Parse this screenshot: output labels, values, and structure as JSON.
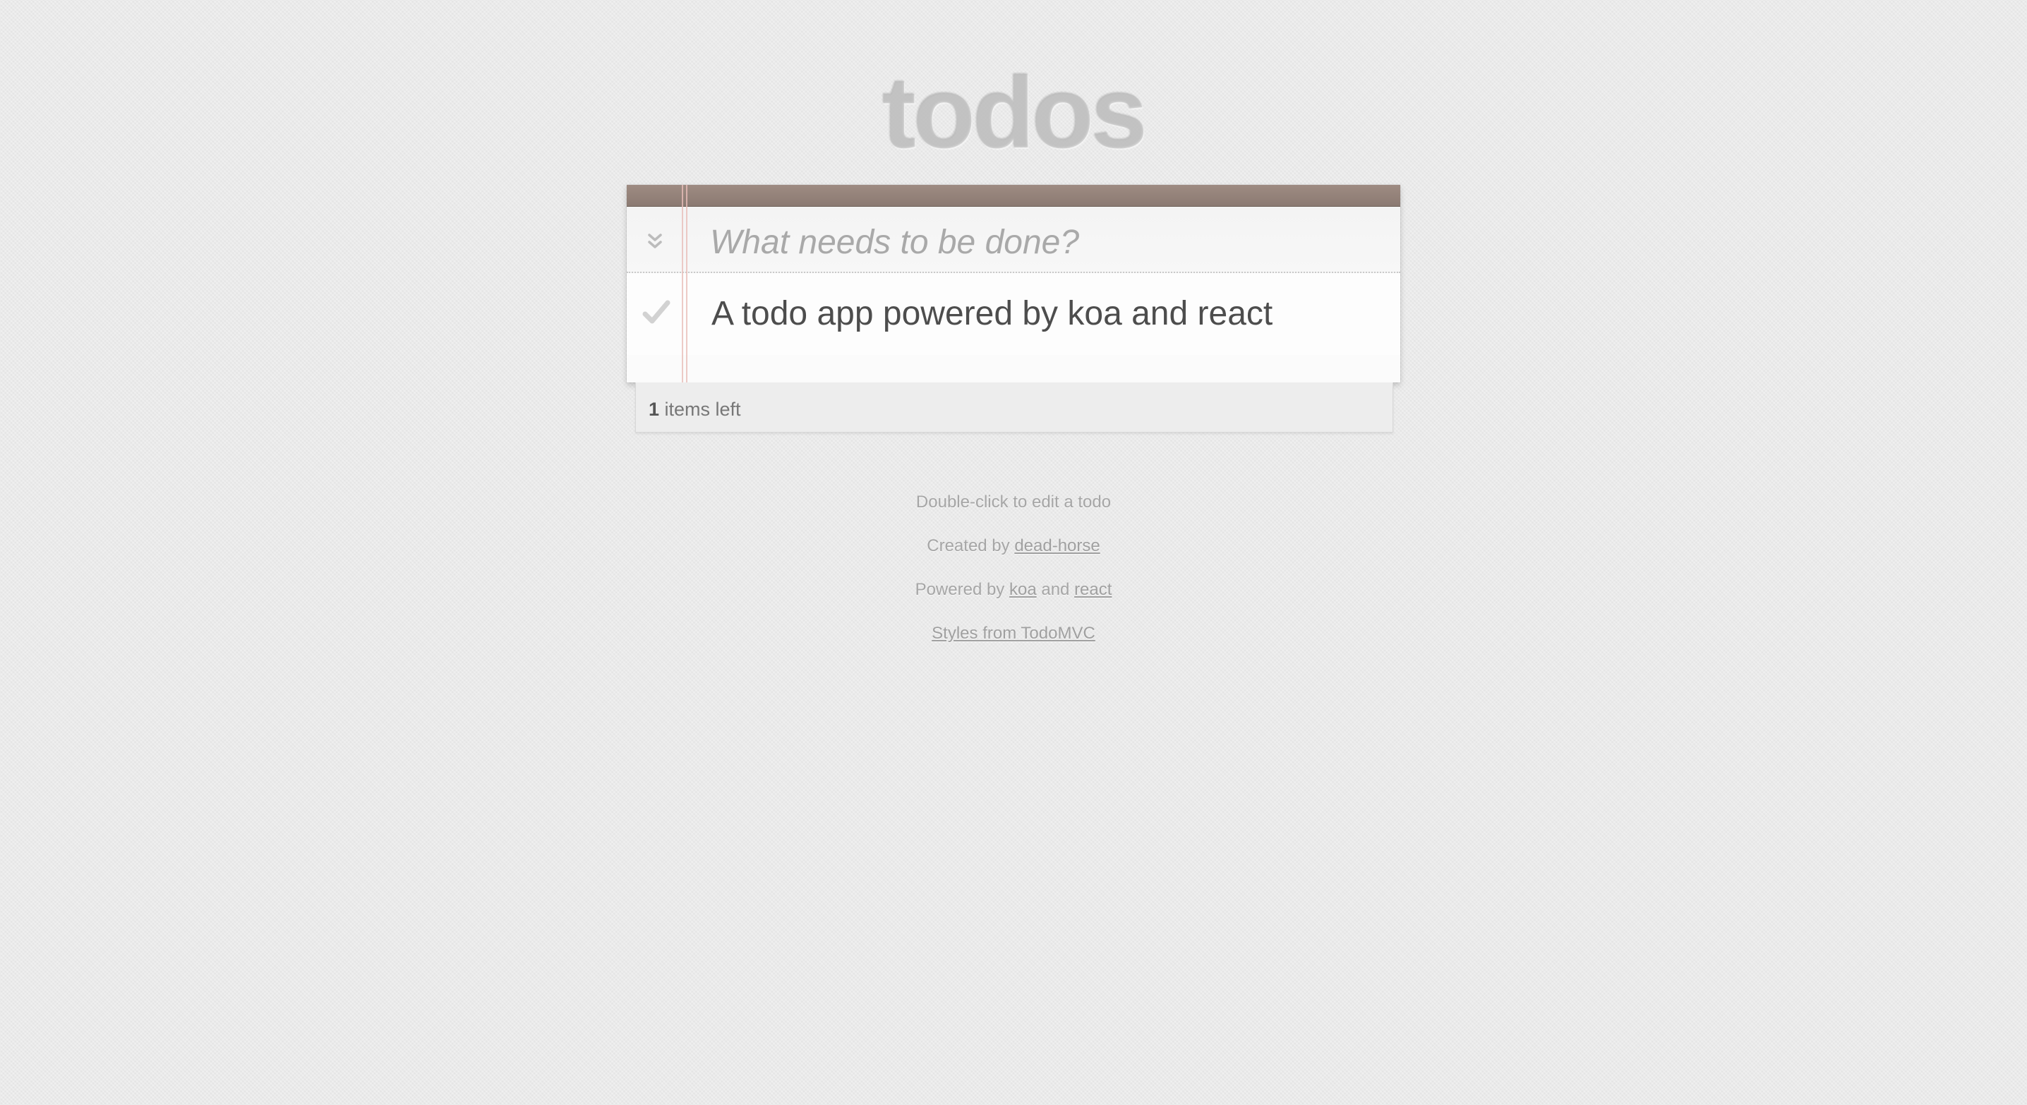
{
  "app": {
    "title": "todos"
  },
  "new_todo": {
    "placeholder": "What needs to be done?",
    "value": "",
    "toggle_all_icon": "double-chevron-down"
  },
  "todos": [
    {
      "title": "A todo app powered by koa and react",
      "completed": false,
      "toggle_icon": "checkmark"
    }
  ],
  "footer": {
    "count": "1",
    "count_suffix": " items left"
  },
  "info": {
    "hint": "Double-click to edit a todo",
    "created_prefix": "Created by ",
    "created_link": "dead-horse",
    "powered_prefix": "Powered by ",
    "powered_link1": "koa",
    "powered_and": " and ",
    "powered_link2": "react",
    "styles_link": "Styles from TodoMVC"
  },
  "colors": {
    "background": "#eaeaea",
    "header_bar": "#8f7d75",
    "title": "#c4c4c4",
    "margin_line": "#e8beb9",
    "text": "#4d4d4d"
  }
}
